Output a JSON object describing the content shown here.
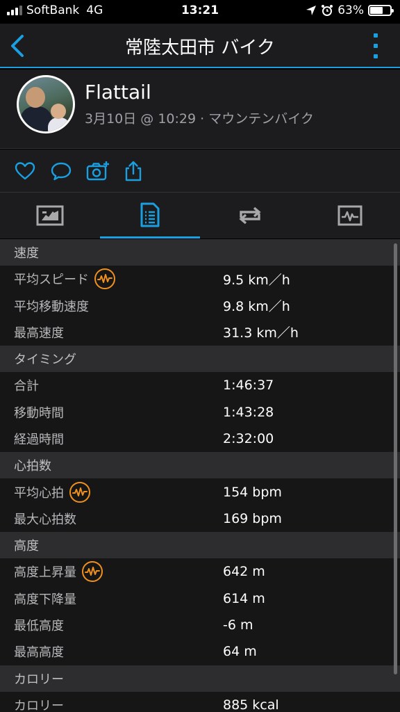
{
  "status_bar": {
    "carrier": "SoftBank",
    "network": "4G",
    "time": "13:21",
    "battery": "63%",
    "battery_level": 0.63
  },
  "nav": {
    "title": "常陸太田市 バイク",
    "back_icon": "chevron-left-icon",
    "more_icon": "more-vertical-icon"
  },
  "profile": {
    "name": "Flattail",
    "meta": "3月10日 @ 10:29 · マウンテンバイク"
  },
  "actions": [
    "heart-icon",
    "comment-icon",
    "camera-add-icon",
    "share-icon"
  ],
  "tabs": [
    {
      "icon": "overview-icon",
      "active": false
    },
    {
      "icon": "stats-list-icon",
      "active": true
    },
    {
      "icon": "laps-icon",
      "active": false
    },
    {
      "icon": "chart-icon",
      "active": false
    }
  ],
  "sections": [
    {
      "title": "速度",
      "rows": [
        {
          "label": "平均スピード",
          "value": "9.5 km／h",
          "badge": true
        },
        {
          "label": "平均移動速度",
          "value": "9.8 km／h",
          "badge": false
        },
        {
          "label": "最高速度",
          "value": "31.3 km／h",
          "badge": false
        }
      ]
    },
    {
      "title": "タイミング",
      "rows": [
        {
          "label": "合計",
          "value": "1:46:37",
          "badge": false
        },
        {
          "label": "移動時間",
          "value": "1:43:28",
          "badge": false
        },
        {
          "label": "経過時間",
          "value": "2:32:00",
          "badge": false
        }
      ]
    },
    {
      "title": "心拍数",
      "rows": [
        {
          "label": "平均心拍",
          "value": "154 bpm",
          "badge": true
        },
        {
          "label": "最大心拍数",
          "value": "169 bpm",
          "badge": false
        }
      ]
    },
    {
      "title": "高度",
      "rows": [
        {
          "label": "高度上昇量",
          "value": "642 m",
          "badge": true
        },
        {
          "label": "高度下降量",
          "value": "614 m",
          "badge": false
        },
        {
          "label": "最低高度",
          "value": "-6 m",
          "badge": false
        },
        {
          "label": "最高高度",
          "value": "64 m",
          "badge": false
        }
      ]
    },
    {
      "title": "カロリー",
      "rows": [
        {
          "label": "カロリー",
          "value": "885 kcal",
          "badge": false
        }
      ]
    }
  ],
  "colors": {
    "accent": "#1a9fe0",
    "badge": "#f0901e"
  }
}
